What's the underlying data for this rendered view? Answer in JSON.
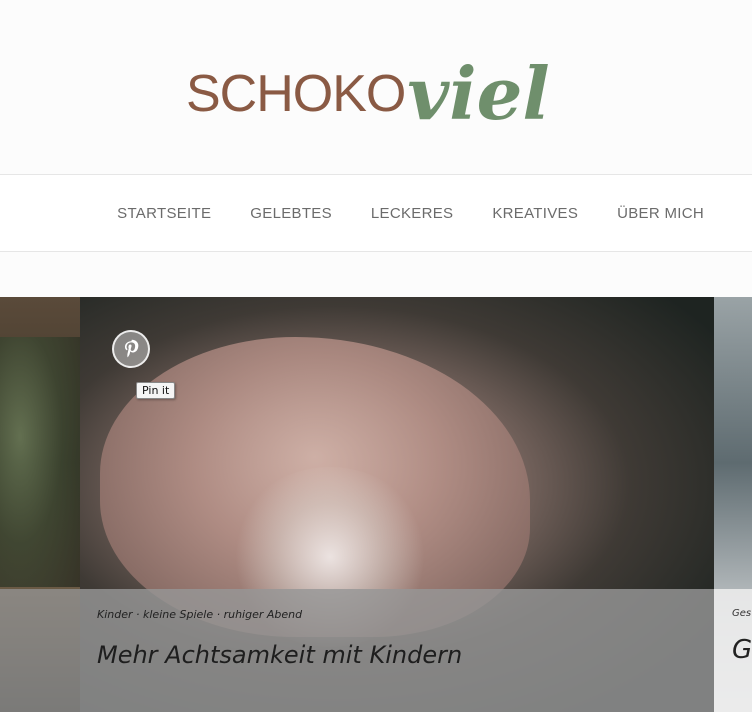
{
  "header": {
    "logo_main": "SCHOKO",
    "logo_script": "viel",
    "colors": {
      "logo_main": "#8a5a44",
      "logo_script": "#6f8f6c"
    }
  },
  "nav": {
    "items": [
      {
        "label": "STARTSEITE"
      },
      {
        "label": "GELEBTES"
      },
      {
        "label": "LECKERES"
      },
      {
        "label": "KREATIVES"
      },
      {
        "label": "ÜBER MICH"
      }
    ]
  },
  "slider": {
    "main": {
      "tags": "Kinder · kleine Spiele · ruhiger Abend",
      "title": "Mehr Achtsamkeit mit Kindern"
    },
    "right": {
      "tags_partial": "Ges",
      "title_partial": "G"
    }
  },
  "pinterest": {
    "icon": "pinterest-icon",
    "tooltip": "Pin it"
  }
}
